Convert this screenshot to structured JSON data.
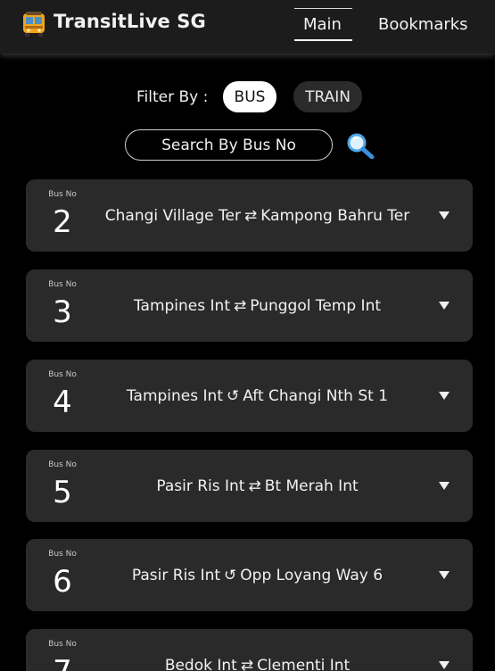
{
  "header": {
    "title": "TransitLive SG",
    "logo_icon": "bus-icon",
    "tabs": [
      {
        "label": "Main",
        "active": true
      },
      {
        "label": "Bookmarks",
        "active": false
      }
    ]
  },
  "filter": {
    "label": "Filter By :",
    "options": [
      {
        "label": "BUS",
        "selected": true
      },
      {
        "label": "TRAIN",
        "selected": false
      }
    ]
  },
  "search": {
    "placeholder": "Search By Bus No",
    "icon": "magnifier-icon"
  },
  "bus_label": "Bus No",
  "buses": [
    {
      "number": "2",
      "from": "Changi Village Ter",
      "symbol": "⇄",
      "to": "Kampong Bahru Ter"
    },
    {
      "number": "3",
      "from": "Tampines Int",
      "symbol": "⇄",
      "to": "Punggol Temp Int"
    },
    {
      "number": "4",
      "from": "Tampines Int",
      "symbol": "↺",
      "to": "Aft Changi Nth St 1"
    },
    {
      "number": "5",
      "from": "Pasir Ris Int",
      "symbol": "⇄",
      "to": "Bt Merah Int"
    },
    {
      "number": "6",
      "from": "Pasir Ris Int",
      "symbol": "↺",
      "to": "Opp Loyang Way 6"
    },
    {
      "number": "7",
      "from": "Bedok Int",
      "symbol": "⇄",
      "to": "Clementi Int"
    }
  ],
  "colors": {
    "background": "#000000",
    "header": "#1c1c1c",
    "card": "#2a2a2a",
    "chip_selected": "#ffffff",
    "chip_unselected": "#2b2b2b"
  }
}
